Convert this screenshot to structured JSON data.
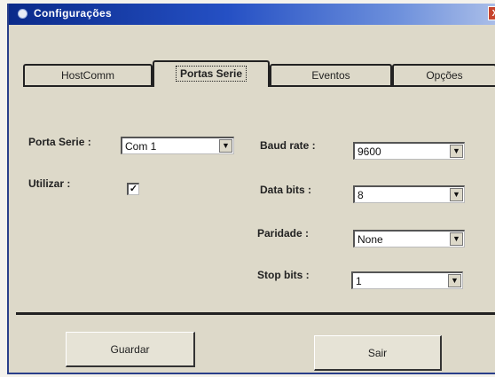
{
  "window": {
    "title": "Configurações",
    "close_label": "X"
  },
  "tabs": [
    {
      "label": "HostComm",
      "active": false
    },
    {
      "label": "Portas Serie",
      "active": true
    },
    {
      "label": "Eventos",
      "active": false
    },
    {
      "label": "Opções",
      "active": false
    }
  ],
  "form": {
    "porta_serie": {
      "label": "Porta Serie :",
      "value": "Com 1"
    },
    "utilizar": {
      "label": "Utilizar :",
      "checked": true,
      "check_glyph": "✓"
    },
    "baud_rate": {
      "label": "Baud rate :",
      "value": "9600"
    },
    "data_bits": {
      "label": "Data bits :",
      "value": "8"
    },
    "paridade": {
      "label": "Paridade :",
      "value": "None"
    },
    "stop_bits": {
      "label": "Stop bits :",
      "value": "1"
    },
    "arrow_glyph": "▼"
  },
  "buttons": {
    "save_label": "Guardar",
    "exit_label": "Sair"
  },
  "colors": {
    "title_bar_start": "#0a2a8a",
    "title_bar_end": "#a9bde8",
    "dialog_bg": "#ddd9c9"
  }
}
